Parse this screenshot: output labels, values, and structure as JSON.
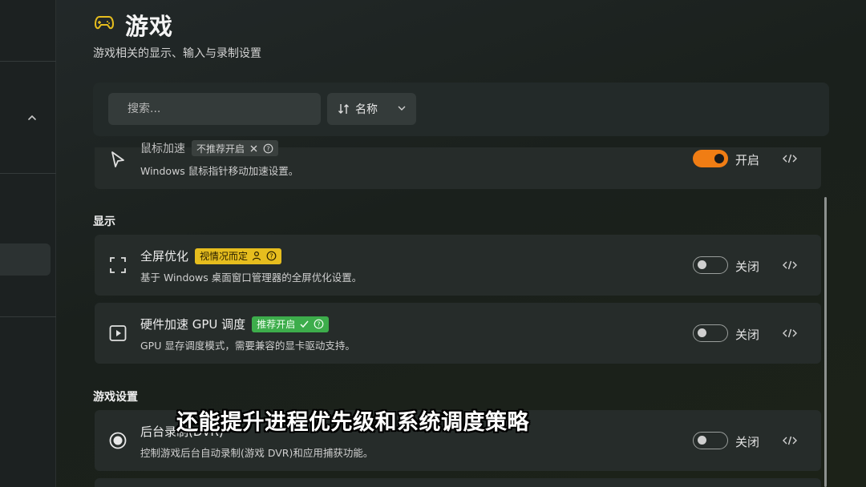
{
  "header": {
    "title": "游戏",
    "subtitle": "游戏相关的显示、输入与录制设置"
  },
  "toolbar": {
    "search_placeholder": "搜索...",
    "sort_label": "名称"
  },
  "cards": {
    "mouse": {
      "title": "鼠标加速",
      "badge": "不推荐开启",
      "desc": "Windows 鼠标指针移动加速设置。",
      "state_label": "开启",
      "enabled": true
    },
    "fullscreen": {
      "title": "全屏优化",
      "badge": "视情况而定",
      "desc": "基于 Windows 桌面窗口管理器的全屏优化设置。",
      "state_label": "关闭",
      "enabled": false
    },
    "gpu": {
      "title": "硬件加速 GPU 调度",
      "badge": "推荐开启",
      "desc": "GPU 显存调度模式，需要兼容的显卡驱动支持。",
      "state_label": "关闭",
      "enabled": false
    },
    "dvr": {
      "title": "后台录制(DVR)",
      "desc": "控制游戏后台自动录制(游戏 DVR)和应用捕获功能。",
      "state_label": "关闭",
      "enabled": false
    }
  },
  "sections": {
    "display": "显示",
    "game_settings": "游戏设置"
  },
  "caption": "还能提升进程优先级和系统调度策略",
  "colors": {
    "accent_orange": "#f07d14",
    "badge_yellow": "#e6bd1e",
    "badge_green": "#3dad4b",
    "title_icon": "#e6bd1e"
  }
}
